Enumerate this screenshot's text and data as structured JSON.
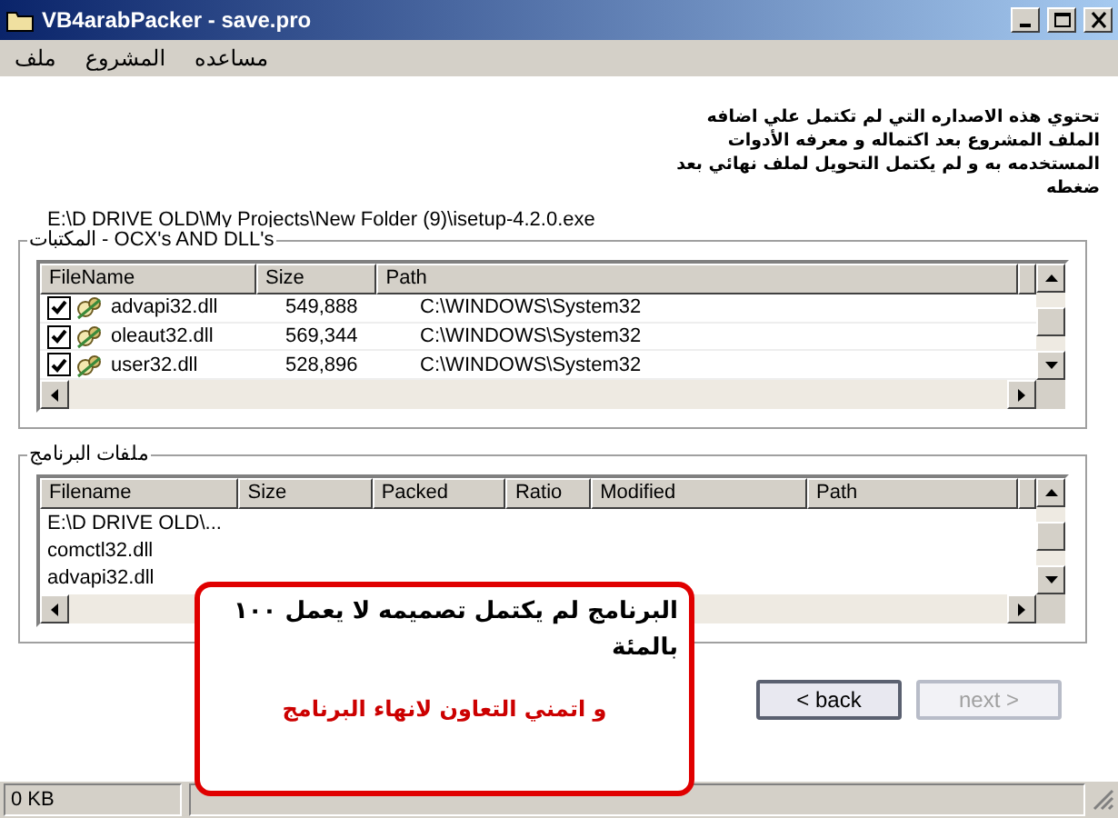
{
  "window": {
    "title": "VB4arabPacker - save.pro"
  },
  "menu": [
    "مساعده",
    "المشروع",
    "ملف"
  ],
  "description": "تحتوي هذه الاصداره التي لم تكتمل علي اضافه الملف  المشروع بعد اكتماله و معرفه الأدوات المستخدمه به و لم يكتمل التحويل لملف نهائي بعد ضغطه",
  "path": "E:\\D DRIVE OLD\\My Projects\\New Folder (9)\\isetup-4.2.0.exe",
  "libraries": {
    "legend": "المكتبات - OCX's AND DLL's",
    "columns": [
      "Path",
      "Size",
      "FileName"
    ],
    "rows": [
      {
        "name": "advapi32.dll",
        "size": "549,888",
        "path": "C:\\WINDOWS\\System32",
        "checked": true
      },
      {
        "name": "oleaut32.dll",
        "size": "569,344",
        "path": "C:\\WINDOWS\\System32",
        "checked": true
      },
      {
        "name": "user32.dll",
        "size": "528,896",
        "path": "C:\\WINDOWS\\System32",
        "checked": true
      }
    ]
  },
  "files": {
    "legend": "ملفات البرنامج",
    "columns": [
      "Path",
      "Modified",
      "Ratio",
      "Packed",
      "Size",
      "Filename"
    ],
    "rows": [
      "E:\\D DRIVE OLD\\...",
      "comctl32.dll",
      "advapi32.dll"
    ]
  },
  "buttons": [
    {
      "label": "next >",
      "disabled": true
    },
    {
      "label": "< back",
      "disabled": false
    }
  ],
  "notice": {
    "message": "البرنامج لم يكتمل تصميمه لا يعمل ١٠٠ بالمئة",
    "appeal": "و اتمني التعاون لانهاء البرنامج"
  },
  "status_bar": [
    "0 KB"
  ]
}
